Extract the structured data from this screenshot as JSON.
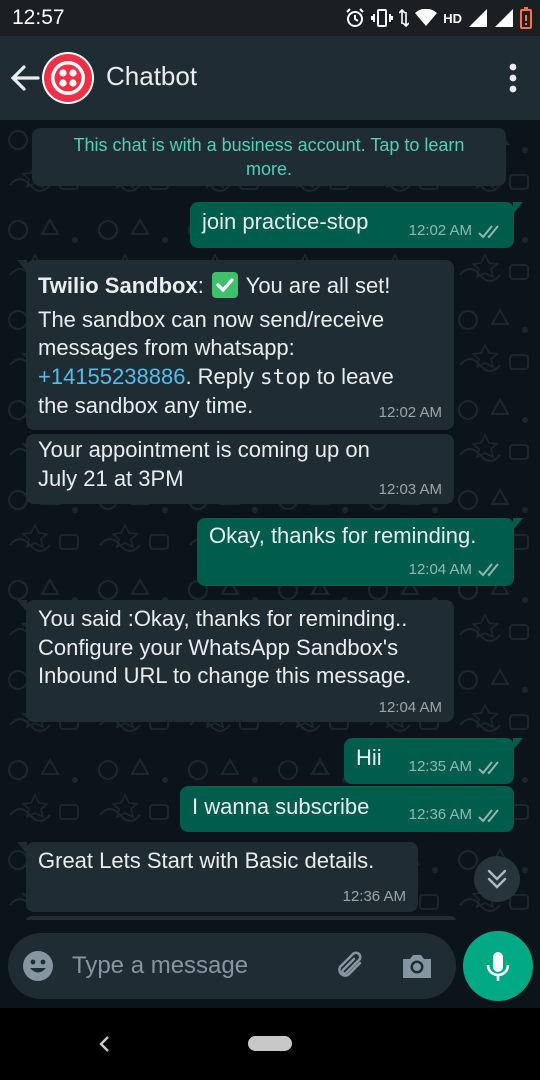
{
  "status_bar": {
    "time": "12:57",
    "network": "HD"
  },
  "header": {
    "title": "Chatbot"
  },
  "notice": "This chat is with a business account. Tap to learn\nmore.",
  "messages": [
    {
      "dir": "out",
      "text": "join practice-stop",
      "time": "12:02 AM",
      "read": true
    },
    {
      "dir": "in",
      "sender": "Twilio Sandbox",
      "check_text": "You are all set!",
      "line2": "The sandbox can now send/receive",
      "line3": "messages from whatsapp:",
      "phone": "+14155238886",
      "reply_pre": ". Reply ",
      "keyword": "stop",
      "reply_post": " to leave",
      "line5": "the sandbox any time.",
      "time": "12:02 AM"
    },
    {
      "dir": "in",
      "text": "Your appointment is coming up on\nJuly 21 at 3PM",
      "time": "12:03 AM"
    },
    {
      "dir": "out",
      "text": "Okay, thanks for reminding.",
      "time": "12:04 AM",
      "read": true
    },
    {
      "dir": "in",
      "text": "You said :Okay, thanks for reminding..\nConfigure your WhatsApp Sandbox's\nInbound URL to change this message.",
      "time": "12:04 AM"
    },
    {
      "dir": "out",
      "text": "Hii",
      "time": "12:35 AM",
      "read": true
    },
    {
      "dir": "out",
      "text": "I wanna subscribe",
      "time": "12:36 AM",
      "read": true
    },
    {
      "dir": "in",
      "text": "Great Lets Start with Basic details.",
      "time": "12:36 AM"
    }
  ],
  "composer": {
    "placeholder": "Type a message"
  },
  "colors": {
    "outgoing": "#005c4b",
    "incoming": "#1f2c34",
    "accent": "#00a884",
    "link": "#53bdeb"
  },
  "icons": [
    "back-arrow-icon",
    "twilio-logo-icon",
    "more-vert-icon",
    "double-check-icon",
    "chevrons-down-icon",
    "emoji-icon",
    "attach-icon",
    "camera-icon",
    "mic-icon"
  ]
}
